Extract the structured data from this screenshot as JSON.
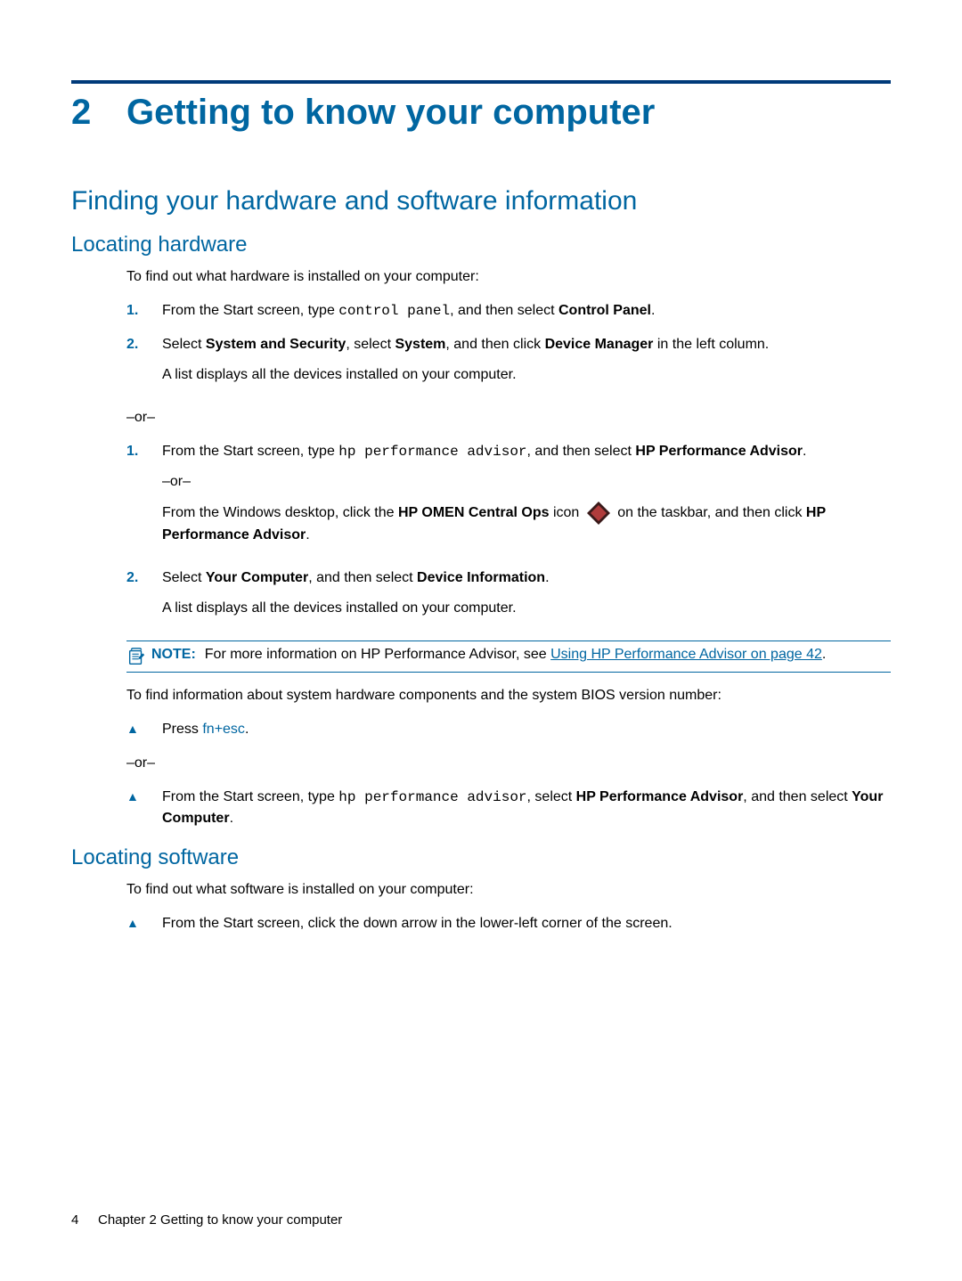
{
  "chapter": {
    "number": "2",
    "title": "Getting to know your computer"
  },
  "section1": {
    "heading": "Finding your hardware and software information",
    "sub1": {
      "heading": "Locating hardware",
      "intro": "To find out what hardware is installed on your computer:",
      "listA": {
        "item1": {
          "marker": "1.",
          "text_a": "From the Start screen, type ",
          "code": "control panel",
          "text_b": ", and then select ",
          "bold": "Control Panel",
          "text_c": "."
        },
        "item2": {
          "marker": "2.",
          "text_a": "Select ",
          "bold1": "System and Security",
          "text_b": ", select ",
          "bold2": "System",
          "text_c": ", and then click ",
          "bold3": "Device Manager",
          "text_d": " in the left column."
        },
        "item2_follow": "A list displays all the devices installed on your computer."
      },
      "or1": "–or–",
      "listB": {
        "item1": {
          "marker": "1.",
          "text_a": "From the Start screen, type ",
          "code": "hp performance advisor",
          "text_b": ", and then select ",
          "bold": "HP Performance Advisor",
          "text_c": "."
        },
        "or_inner": "–or–",
        "desktop": {
          "text_a": "From the Windows desktop, click the ",
          "bold1": "HP OMEN Central Ops",
          "text_b": " icon ",
          "text_c": " on the taskbar, and then click ",
          "bold2": "HP Performance Advisor",
          "text_d": "."
        },
        "item2": {
          "marker": "2.",
          "text_a": "Select ",
          "bold1": "Your Computer",
          "text_b": ", and then select ",
          "bold2": "Device Information",
          "text_c": "."
        },
        "item2_follow": "A list displays all the devices installed on your computer."
      },
      "note": {
        "label": "NOTE:",
        "text_a": "For more information on HP Performance Advisor, see ",
        "link": "Using HP Performance Advisor on page 42",
        "text_b": "."
      },
      "bios_intro": "To find information about system hardware components and the system BIOS version number:",
      "bios_bullet": {
        "text_a": "Press ",
        "key1": "fn",
        "plus": "+",
        "key2": "esc",
        "text_b": "."
      },
      "or2": "–or–",
      "bios_bullet2": {
        "text_a": "From the Start screen, type ",
        "code": "hp performance advisor",
        "text_b": ", select ",
        "bold1": "HP Performance Advisor",
        "text_c": ", and then select ",
        "bold2": "Your Computer",
        "text_d": "."
      }
    },
    "sub2": {
      "heading": "Locating software",
      "intro": "To find out what software is installed on your computer:",
      "bullet": "From the Start screen, click the down arrow in the lower-left corner of the screen."
    }
  },
  "footer": {
    "page_number": "4",
    "text": "Chapter 2   Getting to know your computer"
  },
  "bullet_glyph": "▲"
}
